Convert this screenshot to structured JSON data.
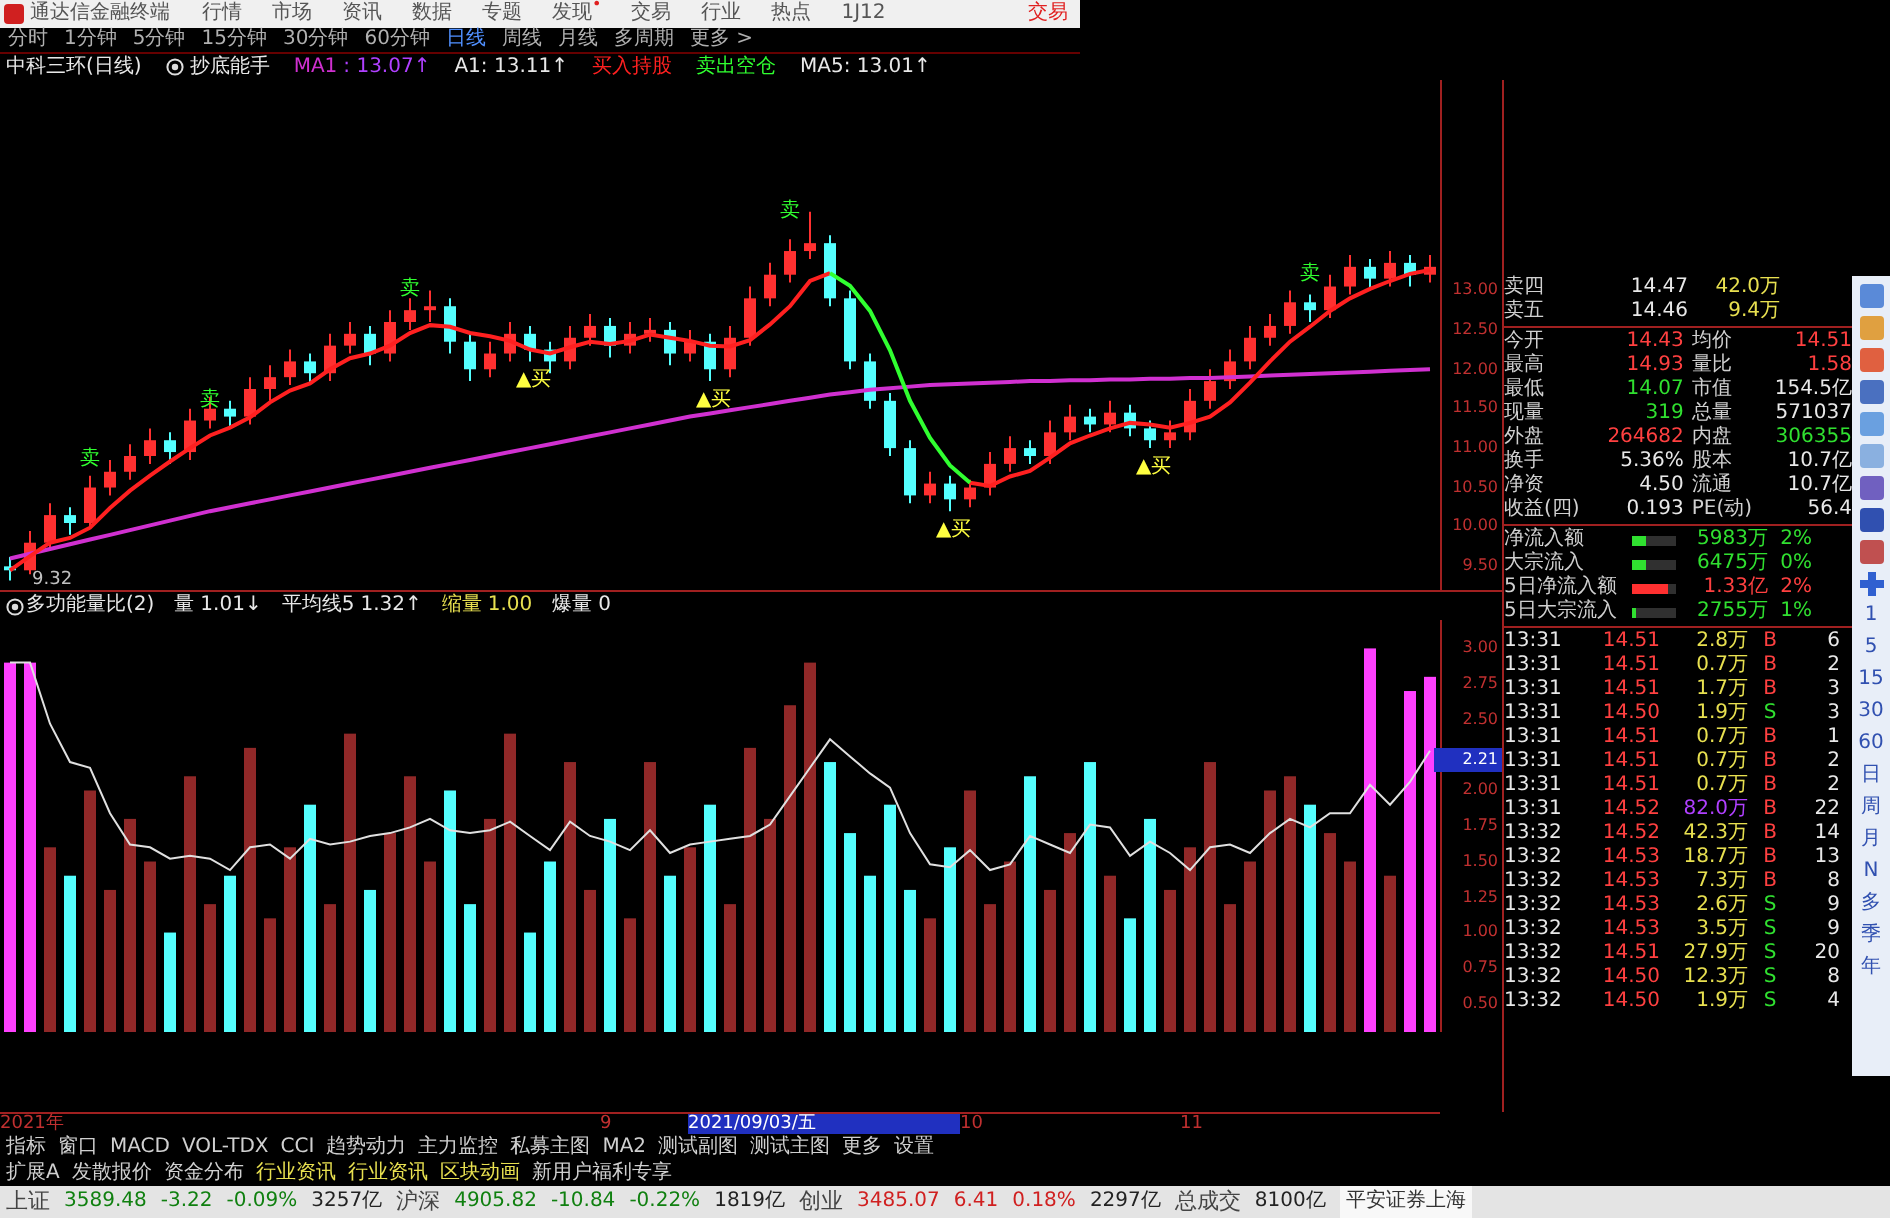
{
  "title_bar": {
    "app_name": "通达信金融终端",
    "menu": [
      {
        "label": "行情"
      },
      {
        "label": "市场"
      },
      {
        "label": "资讯"
      },
      {
        "label": "数据"
      },
      {
        "label": "专题"
      },
      {
        "label": "发现",
        "badge": "•"
      },
      {
        "label": "交易"
      },
      {
        "label": "行业"
      },
      {
        "label": "热点"
      },
      {
        "label": "1J12"
      }
    ],
    "trade_label": "交易"
  },
  "periods": [
    {
      "label": "分时",
      "selected": false
    },
    {
      "label": "1分钟",
      "selected": false
    },
    {
      "label": "5分钟",
      "selected": false
    },
    {
      "label": "15分钟",
      "selected": false
    },
    {
      "label": "30分钟",
      "selected": false
    },
    {
      "label": "60分钟",
      "selected": false
    },
    {
      "label": "日线",
      "selected": true
    },
    {
      "label": "周线",
      "selected": false
    },
    {
      "label": "月线",
      "selected": false
    },
    {
      "label": "多周期",
      "selected": false
    },
    {
      "label": "更多 >",
      "selected": false
    }
  ],
  "indicator_line": {
    "stock": "中科三环(日线)",
    "formula": "抄底能手",
    "items": [
      {
        "text": ": 13.07↑",
        "kind": "ma"
      },
      {
        "text": "A1: 13.11↑",
        "kind": "plain"
      },
      {
        "text": "MA5: 13.01↑",
        "kind": "plain"
      }
    ]
  },
  "price_chart": {
    "chart_data": {
      "type": "candlestick",
      "ylim": [
        9.2,
        15.67
      ],
      "yticks": [
        {
          "value": 13,
          "label": "13.00"
        },
        {
          "value": 12.5,
          "label": "12.50"
        },
        {
          "value": 12,
          "label": "12.00"
        },
        {
          "value": 11.5,
          "label": "11.50"
        },
        {
          "value": 11,
          "label": "11.00"
        },
        {
          "value": 10.5,
          "label": "10.50"
        },
        {
          "value": 10,
          "label": "10.00"
        },
        {
          "value": 9.5,
          "label": "9.50"
        }
      ],
      "ohlc": [
        [
          9.5,
          9.62,
          9.32,
          9.45
        ],
        [
          9.45,
          9.95,
          9.4,
          9.8
        ],
        [
          9.8,
          10.3,
          9.7,
          10.15
        ],
        [
          10.15,
          10.25,
          9.9,
          10.05
        ],
        [
          10.05,
          10.65,
          10.0,
          10.5
        ],
        [
          10.5,
          10.85,
          10.4,
          10.7
        ],
        [
          10.7,
          11.05,
          10.6,
          10.9
        ],
        [
          10.9,
          11.25,
          10.8,
          11.1
        ],
        [
          11.1,
          11.2,
          10.8,
          10.95
        ],
        [
          10.95,
          11.5,
          10.85,
          11.35
        ],
        [
          11.35,
          11.65,
          11.25,
          11.5
        ],
        [
          11.5,
          11.6,
          11.25,
          11.4
        ],
        [
          11.4,
          11.9,
          11.3,
          11.75
        ],
        [
          11.75,
          12.05,
          11.6,
          11.9
        ],
        [
          11.9,
          12.25,
          11.8,
          12.1
        ],
        [
          12.1,
          12.2,
          11.8,
          11.95
        ],
        [
          11.95,
          12.45,
          11.85,
          12.3
        ],
        [
          12.3,
          12.6,
          12.2,
          12.45
        ],
        [
          12.45,
          12.55,
          12.05,
          12.2
        ],
        [
          12.2,
          12.75,
          12.1,
          12.6
        ],
        [
          12.6,
          12.9,
          12.5,
          12.75
        ],
        [
          12.75,
          13.0,
          12.6,
          12.8
        ],
        [
          12.8,
          12.9,
          12.2,
          12.35
        ],
        [
          12.35,
          12.45,
          11.85,
          12.0
        ],
        [
          12.0,
          12.35,
          11.9,
          12.2
        ],
        [
          12.2,
          12.6,
          12.1,
          12.45
        ],
        [
          12.45,
          12.55,
          12.1,
          12.25
        ],
        [
          12.25,
          12.35,
          11.95,
          12.1
        ],
        [
          12.1,
          12.55,
          12.0,
          12.4
        ],
        [
          12.4,
          12.7,
          12.3,
          12.55
        ],
        [
          12.55,
          12.65,
          12.15,
          12.3
        ],
        [
          12.3,
          12.6,
          12.2,
          12.45
        ],
        [
          12.45,
          12.65,
          12.35,
          12.5
        ],
        [
          12.5,
          12.6,
          12.05,
          12.2
        ],
        [
          12.2,
          12.5,
          12.1,
          12.35
        ],
        [
          12.35,
          12.45,
          11.85,
          12.0
        ],
        [
          12.0,
          12.55,
          11.9,
          12.4
        ],
        [
          12.4,
          13.05,
          12.3,
          12.9
        ],
        [
          12.9,
          13.35,
          12.8,
          13.2
        ],
        [
          13.2,
          13.65,
          13.1,
          13.5
        ],
        [
          13.5,
          14.0,
          13.4,
          13.6
        ],
        [
          13.6,
          13.7,
          12.8,
          12.9
        ],
        [
          12.9,
          13.0,
          12.0,
          12.1
        ],
        [
          12.1,
          12.2,
          11.5,
          11.6
        ],
        [
          11.6,
          11.7,
          10.9,
          11.0
        ],
        [
          11.0,
          11.1,
          10.3,
          10.4
        ],
        [
          10.4,
          10.7,
          10.3,
          10.55
        ],
        [
          10.55,
          10.65,
          10.2,
          10.35
        ],
        [
          10.35,
          10.6,
          10.25,
          10.5
        ],
        [
          10.5,
          10.95,
          10.4,
          10.8
        ],
        [
          10.8,
          11.15,
          10.7,
          11.0
        ],
        [
          11.0,
          11.1,
          10.8,
          10.9
        ],
        [
          10.9,
          11.35,
          10.8,
          11.2
        ],
        [
          11.2,
          11.55,
          11.1,
          11.4
        ],
        [
          11.4,
          11.5,
          11.2,
          11.3
        ],
        [
          11.3,
          11.6,
          11.2,
          11.45
        ],
        [
          11.45,
          11.55,
          11.15,
          11.25
        ],
        [
          11.25,
          11.35,
          11.0,
          11.1
        ],
        [
          11.1,
          11.35,
          11.0,
          11.2
        ],
        [
          11.2,
          11.75,
          11.1,
          11.6
        ],
        [
          11.6,
          12.0,
          11.5,
          11.85
        ],
        [
          11.85,
          12.25,
          11.75,
          12.1
        ],
        [
          12.1,
          12.55,
          12.0,
          12.4
        ],
        [
          12.4,
          12.7,
          12.3,
          12.55
        ],
        [
          12.55,
          13.0,
          12.45,
          12.85
        ],
        [
          12.85,
          12.95,
          12.6,
          12.75
        ],
        [
          12.75,
          13.2,
          12.65,
          13.05
        ],
        [
          13.05,
          13.45,
          12.95,
          13.3
        ],
        [
          13.3,
          13.4,
          13.0,
          13.15
        ],
        [
          13.15,
          13.5,
          13.05,
          13.35
        ],
        [
          13.35,
          13.45,
          13.05,
          13.2
        ],
        [
          13.2,
          13.45,
          13.1,
          13.3
        ]
      ],
      "series": [
        {
          "name": "MA1",
          "type": "line",
          "color": "#d030d0",
          "values": [
            9.6,
            9.66,
            9.72,
            9.78,
            9.84,
            9.9,
            9.96,
            10.02,
            10.08,
            10.14,
            10.2,
            10.25,
            10.3,
            10.35,
            10.4,
            10.45,
            10.5,
            10.55,
            10.6,
            10.65,
            10.7,
            10.75,
            10.8,
            10.85,
            10.9,
            10.95,
            11.0,
            11.05,
            11.1,
            11.15,
            11.2,
            11.25,
            11.3,
            11.35,
            11.4,
            11.44,
            11.48,
            11.52,
            11.56,
            11.6,
            11.64,
            11.68,
            11.71,
            11.74,
            11.76,
            11.78,
            11.8,
            11.81,
            11.82,
            11.83,
            11.84,
            11.85,
            11.85,
            11.86,
            11.86,
            11.87,
            11.87,
            11.88,
            11.88,
            11.89,
            11.89,
            11.9,
            11.91,
            11.92,
            11.93,
            11.94,
            11.95,
            11.96,
            11.97,
            11.98,
            11.99,
            12.0
          ]
        },
        {
          "name": "买入持股",
          "type": "line",
          "color": "#ff2020",
          "values": [
            9.45,
            9.63,
            9.8,
            9.86,
            9.99,
            10.24,
            10.46,
            10.65,
            10.83,
            11.0,
            11.16,
            11.26,
            11.39,
            11.58,
            11.73,
            11.82,
            12.0,
            12.14,
            12.2,
            12.3,
            12.46,
            12.56,
            12.54,
            12.46,
            12.42,
            12.36,
            12.25,
            12.2,
            12.28,
            12.35,
            12.32,
            12.36,
            12.44,
            12.4,
            12.36,
            12.3,
            12.29,
            12.37,
            12.57,
            12.8,
            13.12,
            13.22,
            null,
            null,
            null,
            null,
            null,
            null,
            10.56,
            10.52,
            10.64,
            10.71,
            10.88,
            11.06,
            11.16,
            11.25,
            11.32,
            11.3,
            11.26,
            11.32,
            11.4,
            11.58,
            11.83,
            12.1,
            12.35,
            12.54,
            12.74,
            12.9,
            13.02,
            13.12,
            13.21,
            13.26
          ]
        },
        {
          "name": "卖出空仓",
          "type": "line",
          "color": "#30ff30",
          "values": [
            null,
            null,
            null,
            null,
            null,
            null,
            null,
            null,
            null,
            null,
            null,
            null,
            null,
            null,
            null,
            null,
            null,
            null,
            null,
            null,
            null,
            null,
            null,
            null,
            null,
            null,
            null,
            null,
            null,
            null,
            null,
            null,
            null,
            null,
            null,
            null,
            null,
            null,
            null,
            null,
            null,
            13.22,
            13.06,
            12.74,
            12.24,
            11.6,
            11.13,
            10.78,
            10.56,
            null,
            null,
            null,
            null,
            null,
            null,
            null,
            null,
            null,
            null,
            null,
            null,
            null,
            null,
            null,
            null,
            null,
            null,
            null,
            null,
            null,
            null,
            null
          ]
        }
      ]
    },
    "marks": [
      {
        "label": "卖",
        "kind": "sell"
      },
      {
        "label": "卖",
        "kind": "sell"
      },
      {
        "label": "卖",
        "kind": "sell"
      },
      {
        "label": "▲买",
        "kind": "buy"
      },
      {
        "label": "▲买",
        "kind": "buy"
      },
      {
        "label": "卖",
        "kind": "sell"
      },
      {
        "label": "▲买",
        "kind": "buy"
      },
      {
        "label": "▲买",
        "kind": "buy"
      },
      {
        "label": "卖",
        "kind": "sell"
      }
    ],
    "low_label": "9.32"
  },
  "volume_header": {
    "name": "多功能量比(2)",
    "items": [
      {
        "text": "1.01↓",
        "kind": "plain"
      },
      {
        "text": "1.32↑",
        "kind": "plain"
      },
      {
        "text": "1.00",
        "kind": "shrink"
      },
      {
        "text": "0",
        "kind": "plain"
      }
    ]
  },
  "volume_chart": {
    "chart_data": {
      "type": "bar",
      "ylim": [
        0.3,
        3.2
      ],
      "yticks": [
        {
          "value": 3,
          "label": "3.00"
        },
        {
          "value": 2.75,
          "label": "2.75"
        },
        {
          "value": 2.5,
          "label": "2.50"
        },
        {
          "value": 2,
          "label": "2.00"
        },
        {
          "value": 1.75,
          "label": "1.75"
        },
        {
          "value": 1.5,
          "label": "1.50"
        },
        {
          "value": 1.25,
          "label": "1.25"
        },
        {
          "value": 1,
          "label": "1.00"
        },
        {
          "value": 0.75,
          "label": "0.75"
        },
        {
          "value": 0.5,
          "label": "0.50"
        }
      ],
      "series": [
        {
          "name": "缩量",
          "color": "#54ffff",
          "values": [
            null,
            null,
            null,
            1.4,
            null,
            null,
            null,
            null,
            1.0,
            null,
            null,
            1.4,
            null,
            null,
            null,
            1.9,
            null,
            null,
            1.3,
            null,
            null,
            null,
            2.0,
            1.2,
            null,
            null,
            1.0,
            1.5,
            null,
            null,
            1.8,
            null,
            null,
            1.4,
            null,
            1.9,
            null,
            null,
            null,
            null,
            null,
            2.2,
            1.7,
            1.4,
            1.9,
            1.3,
            null,
            1.6,
            null,
            null,
            null,
            2.1,
            null,
            null,
            2.2,
            null,
            1.1,
            1.8,
            null,
            null,
            null,
            null,
            null,
            null,
            null,
            1.9,
            null,
            null,
            null,
            null,
            null,
            null
          ]
        },
        {
          "name": "量",
          "color": "#902828",
          "values": [
            null,
            null,
            1.6,
            null,
            2.0,
            1.3,
            1.8,
            1.5,
            null,
            2.1,
            1.2,
            null,
            2.3,
            1.1,
            1.6,
            null,
            1.2,
            2.4,
            null,
            1.7,
            2.1,
            1.5,
            null,
            null,
            1.8,
            2.4,
            null,
            null,
            2.2,
            1.3,
            null,
            1.1,
            2.2,
            null,
            1.6,
            null,
            1.2,
            2.3,
            1.8,
            2.6,
            2.9,
            null,
            null,
            null,
            null,
            null,
            1.1,
            null,
            2.0,
            1.2,
            1.5,
            null,
            1.3,
            1.7,
            null,
            1.4,
            null,
            null,
            1.3,
            1.6,
            2.2,
            1.2,
            1.5,
            2.0,
            2.1,
            null,
            1.7,
            1.5,
            null,
            1.4,
            null,
            null
          ]
        },
        {
          "name": "平均线5",
          "type": "line",
          "color": "#e0e0e0",
          "values": [
            2.9,
            2.9,
            2.47,
            2.2,
            2.16,
            1.84,
            1.62,
            1.6,
            1.52,
            1.54,
            1.52,
            1.44,
            1.6,
            1.62,
            1.52,
            1.66,
            1.62,
            1.64,
            1.68,
            1.7,
            1.74,
            1.8,
            1.72,
            1.7,
            1.72,
            1.78,
            1.68,
            1.58,
            1.78,
            1.68,
            1.64,
            1.58,
            1.72,
            1.56,
            1.62,
            1.64,
            1.66,
            1.68,
            1.76,
            1.96,
            2.16,
            2.36,
            2.24,
            2.12,
            2.02,
            1.7,
            1.48,
            1.46,
            1.58,
            1.44,
            1.48,
            1.68,
            1.62,
            1.56,
            1.76,
            1.74,
            1.54,
            1.64,
            1.56,
            1.44,
            1.6,
            1.62,
            1.56,
            1.7,
            1.8,
            1.74,
            1.84,
            1.84,
            2.04,
            1.9,
            2.06,
            2.28
          ]
        },
        {
          "name": "爆量",
          "color": "#ff40ff",
          "values": [
            2.9,
            2.9,
            null,
            null,
            null,
            null,
            null,
            null,
            null,
            null,
            null,
            null,
            null,
            null,
            null,
            null,
            null,
            null,
            null,
            null,
            null,
            null,
            null,
            null,
            null,
            null,
            null,
            null,
            null,
            null,
            null,
            null,
            null,
            null,
            null,
            null,
            null,
            null,
            null,
            null,
            null,
            null,
            null,
            null,
            null,
            null,
            null,
            null,
            null,
            null,
            null,
            null,
            null,
            null,
            null,
            null,
            null,
            null,
            null,
            null,
            null,
            null,
            null,
            null,
            null,
            null,
            null,
            null,
            3.0,
            null,
            2.7,
            2.8
          ]
        }
      ]
    },
    "cursor_label": "2.21"
  },
  "quote": {
    "asks": [
      {
        "label": "卖四",
        "price": "14.47",
        "volume": "42.0万"
      },
      {
        "label": "卖五",
        "price": "14.46",
        "volume": "9.4万"
      }
    ],
    "stats": [
      {
        "label": "今开",
        "value": "14.43",
        "kind": "up"
      },
      {
        "label": "均价",
        "value": "14.51",
        "kind": "up"
      },
      {
        "label": "最高",
        "value": "14.93",
        "kind": "up"
      },
      {
        "label": "量比",
        "value": "1.58",
        "kind": "up"
      },
      {
        "label": "最低",
        "value": "14.07",
        "kind": "down"
      },
      {
        "label": "市值",
        "value": "154.5亿",
        "kind": "plain"
      },
      {
        "label": "现量",
        "value": "319",
        "kind": "down"
      },
      {
        "label": "总量",
        "value": "571037",
        "kind": "plain"
      },
      {
        "label": "外盘",
        "value": "264682",
        "kind": "up"
      },
      {
        "label": "内盘",
        "value": "306355",
        "kind": "down"
      },
      {
        "label": "换手",
        "value": "5.36%",
        "kind": "plain"
      },
      {
        "label": "股本",
        "value": "10.7亿",
        "kind": "plain"
      },
      {
        "label": "净资",
        "value": "4.50",
        "kind": "plain"
      },
      {
        "label": "流通",
        "value": "10.7亿",
        "kind": "plain"
      },
      {
        "label": "收益(四)",
        "value": "0.193",
        "kind": "plain"
      },
      {
        "label": "PE(动)",
        "value": "56.4",
        "kind": "plain"
      }
    ],
    "flows": [
      {
        "label": "净流入额",
        "value": "5983万",
        "pct": "2%",
        "kind": "in",
        "level": 0.3
      },
      {
        "label": "大宗流入",
        "value": "6475万",
        "pct": "0%",
        "kind": "in",
        "level": 0.3
      },
      {
        "label": "5日净流入额",
        "value": "1.33亿",
        "pct": "2%",
        "kind": "out",
        "level": 0.8
      },
      {
        "label": "5日大宗流入",
        "value": "2755万",
        "pct": "1%",
        "kind": "in",
        "level": 0.1
      }
    ]
  },
  "trades": [
    {
      "time": "13:31",
      "price": "14.51",
      "volume": "2.8万",
      "side": "B",
      "count": "6",
      "kind": "buy",
      "large": false
    },
    {
      "time": "13:31",
      "price": "14.51",
      "volume": "0.7万",
      "side": "B",
      "count": "2",
      "kind": "buy",
      "large": false
    },
    {
      "time": "13:31",
      "price": "14.51",
      "volume": "1.7万",
      "side": "B",
      "count": "3",
      "kind": "buy",
      "large": false
    },
    {
      "time": "13:31",
      "price": "14.50",
      "volume": "1.9万",
      "side": "S",
      "count": "3",
      "kind": "sell",
      "large": false
    },
    {
      "time": "13:31",
      "price": "14.51",
      "volume": "0.7万",
      "side": "B",
      "count": "1",
      "kind": "buy",
      "large": false
    },
    {
      "time": "13:31",
      "price": "14.51",
      "volume": "0.7万",
      "side": "B",
      "count": "2",
      "kind": "buy",
      "large": false
    },
    {
      "time": "13:31",
      "price": "14.51",
      "volume": "0.7万",
      "side": "B",
      "count": "2",
      "kind": "buy",
      "large": false
    },
    {
      "time": "13:31",
      "price": "14.52",
      "volume": "82.0万",
      "side": "B",
      "count": "22",
      "kind": "buy",
      "large": true
    },
    {
      "time": "13:32",
      "price": "14.52",
      "volume": "42.3万",
      "side": "B",
      "count": "14",
      "kind": "buy",
      "large": false
    },
    {
      "time": "13:32",
      "price": "14.53",
      "volume": "18.7万",
      "side": "B",
      "count": "13",
      "kind": "buy",
      "large": false
    },
    {
      "time": "13:32",
      "price": "14.53",
      "volume": "7.3万",
      "side": "B",
      "count": "8",
      "kind": "buy",
      "large": false
    },
    {
      "time": "13:32",
      "price": "14.53",
      "volume": "2.6万",
      "side": "S",
      "count": "9",
      "kind": "sell",
      "large": false
    },
    {
      "time": "13:32",
      "price": "14.53",
      "volume": "3.5万",
      "side": "S",
      "count": "9",
      "kind": "sell",
      "large": false
    },
    {
      "time": "13:32",
      "price": "14.51",
      "volume": "27.9万",
      "side": "S",
      "count": "20",
      "kind": "sell",
      "large": false
    },
    {
      "time": "13:32",
      "price": "14.50",
      "volume": "12.3万",
      "side": "S",
      "count": "8",
      "kind": "sell",
      "large": false
    },
    {
      "time": "13:32",
      "price": "14.50",
      "volume": "1.9万",
      "side": "S",
      "count": "4",
      "kind": "sell",
      "large": false
    }
  ],
  "side_toolbar": [
    "1",
    "5",
    "15",
    "30",
    "60",
    "日",
    "周",
    "月",
    "N",
    "多",
    "季",
    "年"
  ],
  "date_axis": [
    {
      "label": "2021年",
      "selected": false
    },
    {
      "label": "9",
      "selected": false
    },
    {
      "label": "2021/09/03/五",
      "selected": true
    },
    {
      "label": "10",
      "selected": false
    },
    {
      "label": "11",
      "selected": false
    }
  ],
  "indicator_tabs": [
    "指标",
    "窗口",
    "MACD",
    "VOL-TDX",
    "CCI",
    "趋势动力",
    "主力监控",
    "私募主图",
    "MA2",
    "测试副图",
    "测试主图",
    "更多",
    "设置"
  ],
  "extension_tabs": [
    {
      "label": "扩展A",
      "kind": "plain"
    },
    {
      "label": "发散报价",
      "kind": "plain"
    },
    {
      "label": "资金分布",
      "kind": "plain"
    },
    {
      "label": "行业资讯",
      "kind": "yellow"
    },
    {
      "label": "行业资讯",
      "kind": "yellow"
    },
    {
      "label": "区块动画",
      "kind": "yellow"
    },
    {
      "label": "新用户福利专享",
      "kind": "plain"
    }
  ],
  "status_bar": {
    "indices": [
      {
        "name": "上证",
        "value": "3589.48",
        "change": "-3.22",
        "pct": "-0.09%",
        "amount": "3257亿",
        "kind": "down"
      },
      {
        "name": "沪深",
        "value": "4905.82",
        "change": "-10.84",
        "pct": "-0.22%",
        "amount": "1819亿",
        "kind": "down"
      },
      {
        "name": "创业",
        "value": "3485.07",
        "change": "6.41",
        "pct": "0.18%",
        "amount": "2297亿",
        "kind": "up"
      }
    ],
    "total_label": "总成交",
    "total": "8100亿",
    "broker": "平安证券上海"
  }
}
